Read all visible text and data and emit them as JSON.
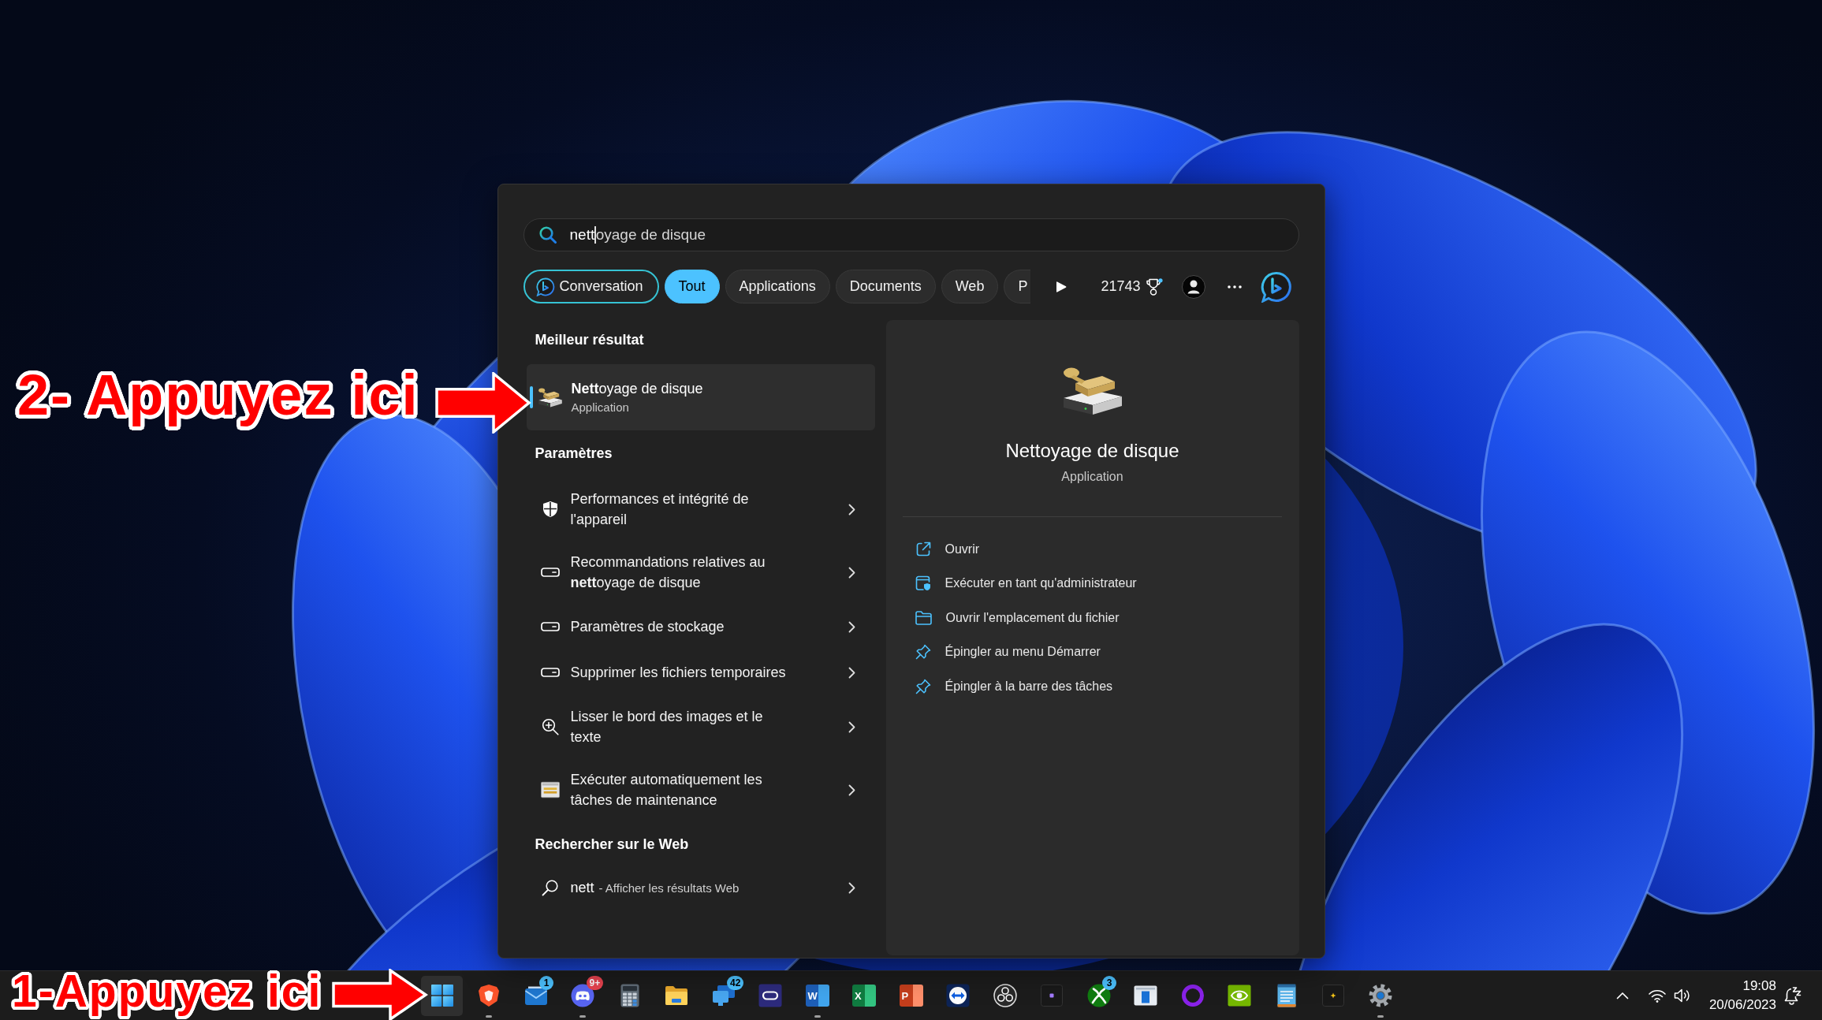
{
  "search": {
    "typed": "nett",
    "completion": "oyage de disque"
  },
  "filters": [
    {
      "label": "Conversation",
      "kind": "chat",
      "selected": false
    },
    {
      "label": "Tout",
      "kind": "filter",
      "selected": true
    },
    {
      "label": "Applications",
      "kind": "filter",
      "selected": false
    },
    {
      "label": "Documents",
      "kind": "filter",
      "selected": false
    },
    {
      "label": "Web",
      "kind": "filter",
      "selected": false
    },
    {
      "label": "P",
      "kind": "clipped",
      "selected": false
    }
  ],
  "rewards": {
    "points": "21743"
  },
  "best_match": {
    "heading": "Meilleur résultat",
    "title": "**Nett**oyage de disque",
    "subtitle": "Application",
    "selected": true
  },
  "settings": {
    "heading": "Paramètres",
    "items": [
      {
        "label": "Performances et intégrité de l'appareil",
        "kind": "shield",
        "selected": false
      },
      {
        "label": "Recommandations relatives au **nett**oyage de disque",
        "kind": "drive",
        "selected": false
      },
      {
        "label": "Paramètres de stockage",
        "kind": "drive",
        "selected": false
      },
      {
        "label": "Supprimer les fichiers temporaires",
        "kind": "drive",
        "selected": false
      },
      {
        "label": "Lisser le bord des images et le texte",
        "kind": "zoom",
        "selected": false
      },
      {
        "label": "Exécuter automatiquement les tâches de maintenance",
        "kind": "panel",
        "selected": false
      }
    ]
  },
  "web": {
    "heading": "Rechercher sur le Web",
    "query": "nett",
    "hint": "- Afficher les résultats Web",
    "selected": false
  },
  "preview": {
    "title": "Nettoyage de disque",
    "subtitle": "Application",
    "actions": [
      {
        "label": "Ouvrir",
        "kind": "open"
      },
      {
        "label": "Exécuter en tant qu'administrateur",
        "kind": "admin"
      },
      {
        "label": "Ouvrir l'emplacement du fichier",
        "kind": "folder"
      },
      {
        "label": "Épingler au menu Démarrer",
        "kind": "pin"
      },
      {
        "label": "Épingler à la barre des tâches",
        "kind": "pin"
      }
    ]
  },
  "taskbar": {
    "start": {
      "selected": true
    },
    "apps": [
      {
        "kind": "shield",
        "running": true
      },
      {
        "kind": "envelope",
        "running": false,
        "badge": {
          "text": "1",
          "color": "#4cc2ff"
        }
      },
      {
        "kind": "gamepad",
        "running": true,
        "badge": {
          "text": "9+",
          "color": "#e8434f"
        }
      },
      {
        "kind": "calculator",
        "running": false
      },
      {
        "kind": "folder",
        "running": false
      },
      {
        "kind": "screens",
        "running": false,
        "badge": {
          "text": "42",
          "color": "#4cc2ff"
        }
      },
      {
        "kind": "oval",
        "running": false
      },
      {
        "kind": "document",
        "glyph": "W",
        "running": true
      },
      {
        "kind": "spreadsheet",
        "glyph": "X",
        "running": false
      },
      {
        "kind": "slides",
        "glyph": "P",
        "running": false
      },
      {
        "kind": "double-arrow",
        "running": false
      },
      {
        "kind": "aperture",
        "running": false
      },
      {
        "kind": "dot-tile",
        "running": false
      },
      {
        "kind": "x-ball",
        "running": false,
        "badge": {
          "text": "3",
          "color": "#4cc2ff"
        }
      },
      {
        "kind": "window",
        "running": false
      },
      {
        "kind": "ring",
        "running": false
      },
      {
        "kind": "swirl",
        "running": false
      },
      {
        "kind": "notepad",
        "running": false
      },
      {
        "kind": "sparkle-tile",
        "running": false
      },
      {
        "kind": "gear",
        "running": true
      }
    ],
    "tray": {
      "time": "19:08",
      "date": "20/06/2023"
    }
  },
  "annotations": [
    {
      "text": "2- Appuyez ici"
    },
    {
      "text": "1-Appuyez ici"
    }
  ]
}
